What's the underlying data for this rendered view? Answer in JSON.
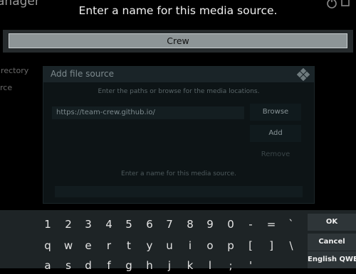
{
  "background": {
    "title": "anager",
    "sidebar": [
      "irectory",
      "rce"
    ]
  },
  "dialog": {
    "title": "Add file source",
    "instruction": "Enter the paths or browse for the media locations.",
    "path": "https://team-crew.github.io/",
    "browse": "Browse",
    "add": "Add",
    "remove": "Remove",
    "name_label": "Enter a name for this media source."
  },
  "keyboard": {
    "prompt": "Enter a name for this media source.",
    "input_value": "Crew",
    "row1": [
      "1",
      "2",
      "3",
      "4",
      "5",
      "6",
      "7",
      "8",
      "9",
      "0",
      "-",
      "=",
      "`"
    ],
    "row2": [
      "q",
      "w",
      "e",
      "r",
      "t",
      "y",
      "u",
      "i",
      "o",
      "p",
      "[",
      "]",
      "\\"
    ],
    "row3": [
      "a",
      "s",
      "d",
      "f",
      "g",
      "h",
      "j",
      "k",
      "l",
      ";",
      "'"
    ],
    "ok": "OK",
    "cancel": "Cancel",
    "layout": "English QWE"
  }
}
